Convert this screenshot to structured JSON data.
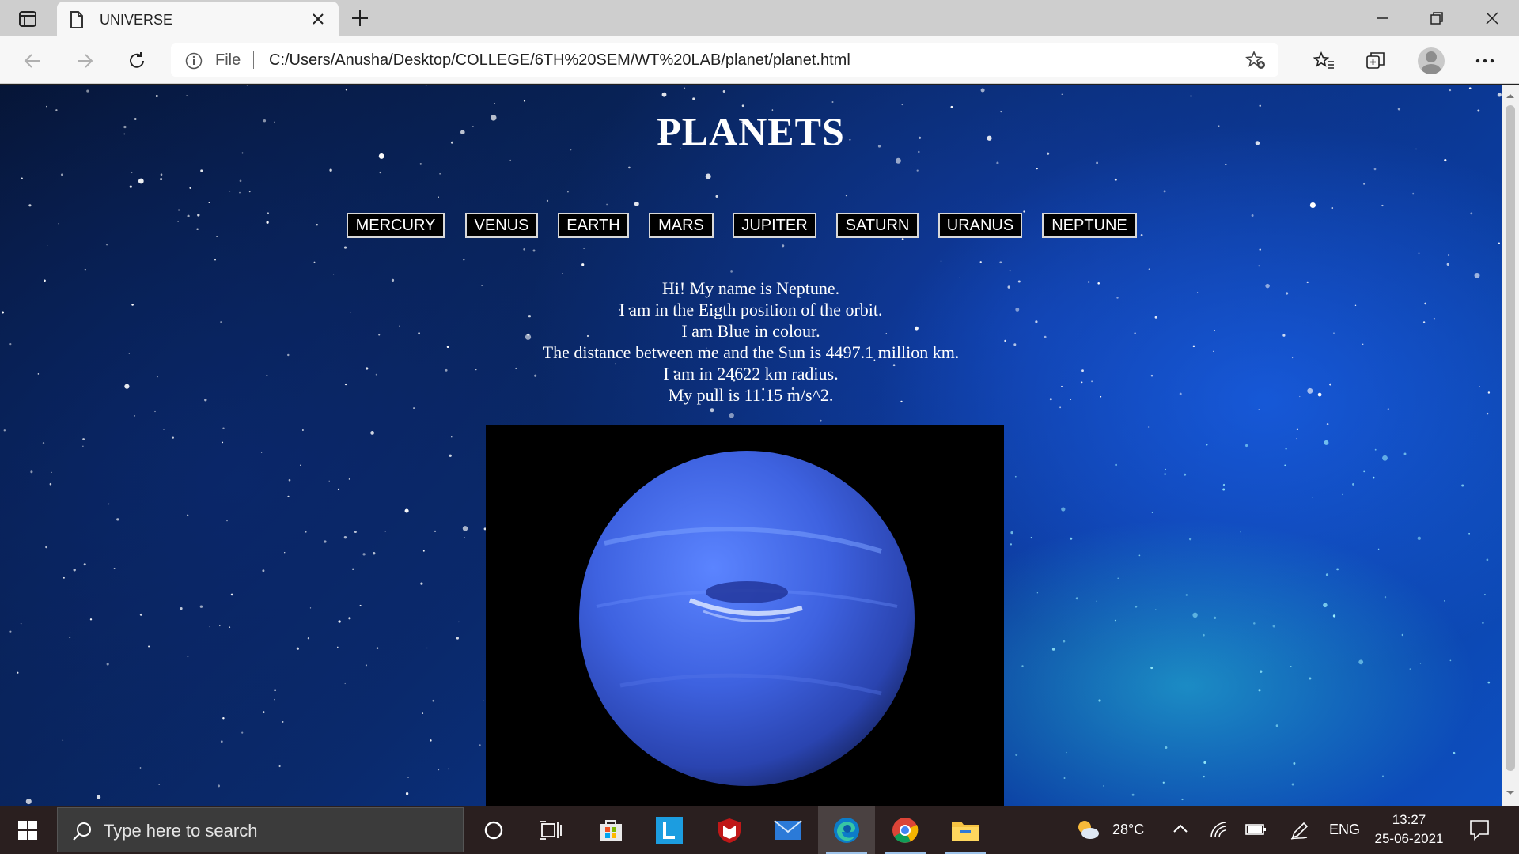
{
  "browser": {
    "tab_title": "UNIVERSE",
    "address_prefix": "File",
    "url": "C:/Users/Anusha/Desktop/COLLEGE/6TH%20SEM/WT%20LAB/planet/planet.html"
  },
  "page": {
    "title": "PLANETS",
    "nav": [
      "MERCURY",
      "VENUS",
      "EARTH",
      "MARS",
      "JUPITER",
      "SATURN",
      "URANUS",
      "NEPTUNE"
    ],
    "info_lines": [
      "Hi! My name is Neptune.",
      "I am in the Eigth position of the orbit.",
      "I am Blue in colour.",
      "The distance between me and the Sun is 4497.1 million km.",
      "I am in 24622 km radius.",
      "My pull is 11.15 m/s^2."
    ]
  },
  "taskbar": {
    "search_placeholder": "Type here to search",
    "weather": "28°C",
    "language": "ENG",
    "time": "13:27",
    "date": "25-06-2021"
  },
  "colors": {
    "nav_button_bg": "#000000",
    "planet_blue": "#3f63d8"
  }
}
